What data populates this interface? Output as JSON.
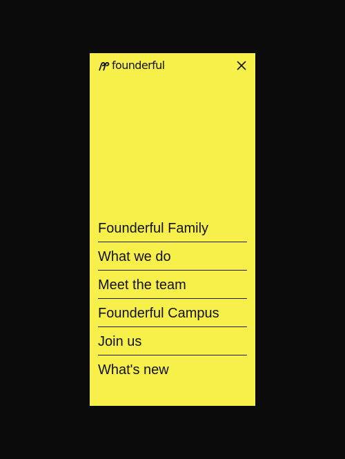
{
  "brand": {
    "name": "founderful",
    "icon": "founderful-logo-mark"
  },
  "header": {
    "close_icon": "close-icon"
  },
  "menu": {
    "items": [
      {
        "label": "Founderful Family"
      },
      {
        "label": "What we do"
      },
      {
        "label": "Meet the team"
      },
      {
        "label": "Founderful Campus"
      },
      {
        "label": "Join us"
      },
      {
        "label": "What's new"
      }
    ]
  },
  "colors": {
    "background": "#0b0b0b",
    "panel": "#f7ef4a",
    "text": "#111111"
  }
}
